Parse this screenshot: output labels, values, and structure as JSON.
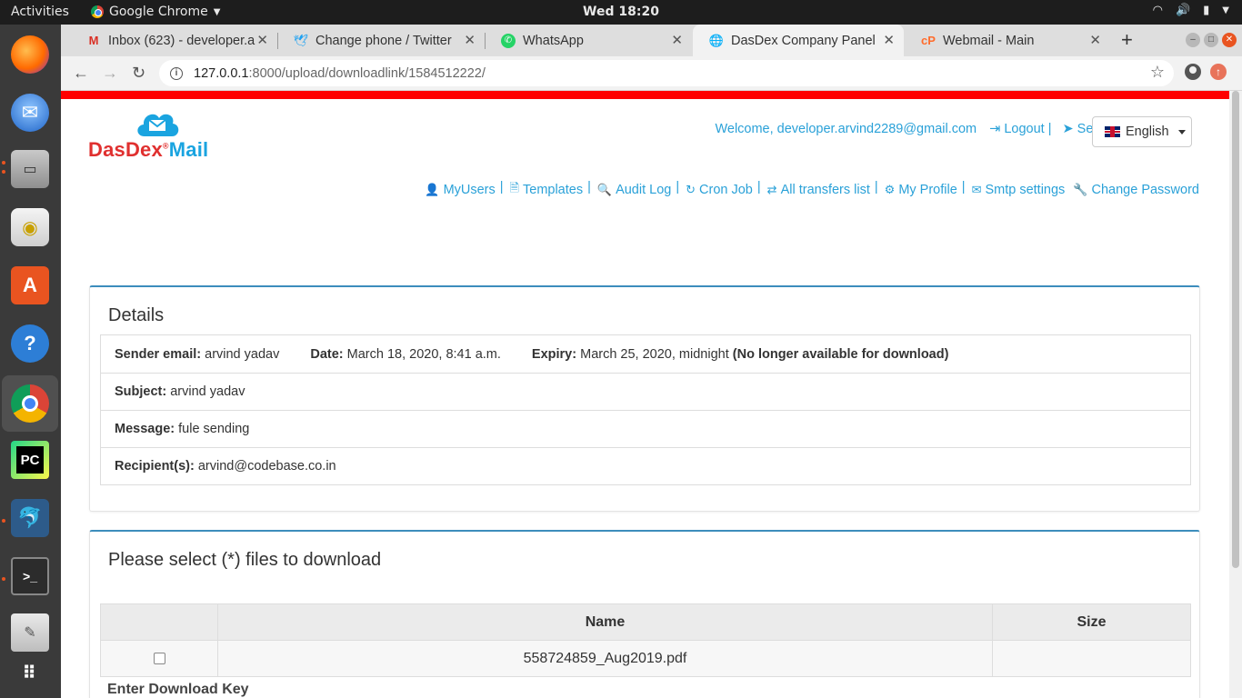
{
  "topbar": {
    "activities": "Activities",
    "app_name": "Google Chrome",
    "clock": "Wed 18:20"
  },
  "tabs": [
    {
      "title": "Inbox (623) - developer.a",
      "icon": "gmail-icon"
    },
    {
      "title": "Change phone / Twitter",
      "icon": "twitter-icon"
    },
    {
      "title": "WhatsApp",
      "icon": "whatsapp-icon"
    },
    {
      "title": "DasDex Company Panel",
      "icon": "globe-icon",
      "active": true
    },
    {
      "title": "Webmail - Main",
      "icon": "cpanel-icon"
    }
  ],
  "address_bar": {
    "host": "127.0.0.1",
    "path": ":8000/upload/downloadlink/1584512222/"
  },
  "brand": {
    "part1": "DasDex",
    "registered": "®",
    "part2": "Mail",
    "accent": "#1aa4e0",
    "red": "#e0302f"
  },
  "userbar": {
    "welcome": "Welcome, developer.arvind2289@gmail.com",
    "logout": "Logout |",
    "send_file": "Send a file |",
    "language": "English"
  },
  "nav_links": [
    {
      "label": "MyUsers",
      "icon": "user-icon"
    },
    {
      "label": "Templates",
      "icon": "file-icon"
    },
    {
      "label": "Audit Log",
      "icon": "search-icon"
    },
    {
      "label": "Cron Job",
      "icon": "refresh-icon"
    },
    {
      "label": "All transfers list",
      "icon": "transfer-icon"
    },
    {
      "label": "My Profile",
      "icon": "gear-icon"
    },
    {
      "label": "Smtp settings",
      "icon": "envelope-icon"
    },
    {
      "label": "Change Password",
      "icon": "wrench-icon"
    }
  ],
  "details": {
    "title": "Details",
    "sender_label": "Sender email:",
    "sender_value": "arvind yadav",
    "date_label": "Date:",
    "date_value": "March 18, 2020, 8:41 a.m.",
    "expiry_label": "Expiry:",
    "expiry_value": "March 25, 2020, midnight",
    "expiry_note": "(No longer available for download)",
    "subject_label": "Subject:",
    "subject_value": "arvind yadav",
    "message_label": "Message:",
    "message_value": "fule sending",
    "recipients_label": "Recipient(s):",
    "recipients_value": "arvind@codebase.co.in"
  },
  "files": {
    "title": "Please select (*) files to download",
    "col_name": "Name",
    "col_size": "Size",
    "rows": [
      {
        "name": "558724859_Aug2019.pdf",
        "size": ""
      }
    ],
    "key_label": "Enter Download Key"
  }
}
